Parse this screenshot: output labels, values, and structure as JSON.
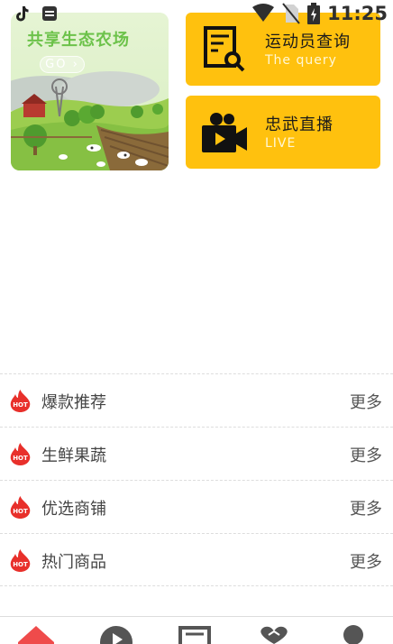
{
  "status_bar": {
    "time": "11:25",
    "icons": [
      "tiktok-icon",
      "app-notification-icon",
      "wifi-icon",
      "no-sim-icon",
      "battery-charging-icon"
    ]
  },
  "banner": {
    "title": "共享生态农场",
    "go_label": "GO ›"
  },
  "tiles": [
    {
      "title": "运动员查询",
      "subtitle": "The query",
      "icon": "document-search-icon"
    },
    {
      "title": "忠武直播",
      "subtitle": "LIVE",
      "icon": "video-camera-icon"
    }
  ],
  "sections": [
    {
      "label": "爆款推荐",
      "more": "更多",
      "badge": "HOT"
    },
    {
      "label": "生鲜果蔬",
      "more": "更多",
      "badge": "HOT"
    },
    {
      "label": "优选商铺",
      "more": "更多",
      "badge": "HOT"
    },
    {
      "label": "热门商品",
      "more": "更多",
      "badge": "HOT"
    }
  ],
  "bottom_nav": {
    "icons": [
      "home-icon",
      "play-icon",
      "news-icon",
      "love-icon",
      "profile-icon"
    ],
    "active_color": "#ef4b4b"
  },
  "colors": {
    "accent_yellow": "#ffc10e",
    "hot_red": "#e8302b",
    "farm_green": "#6cc24a"
  }
}
